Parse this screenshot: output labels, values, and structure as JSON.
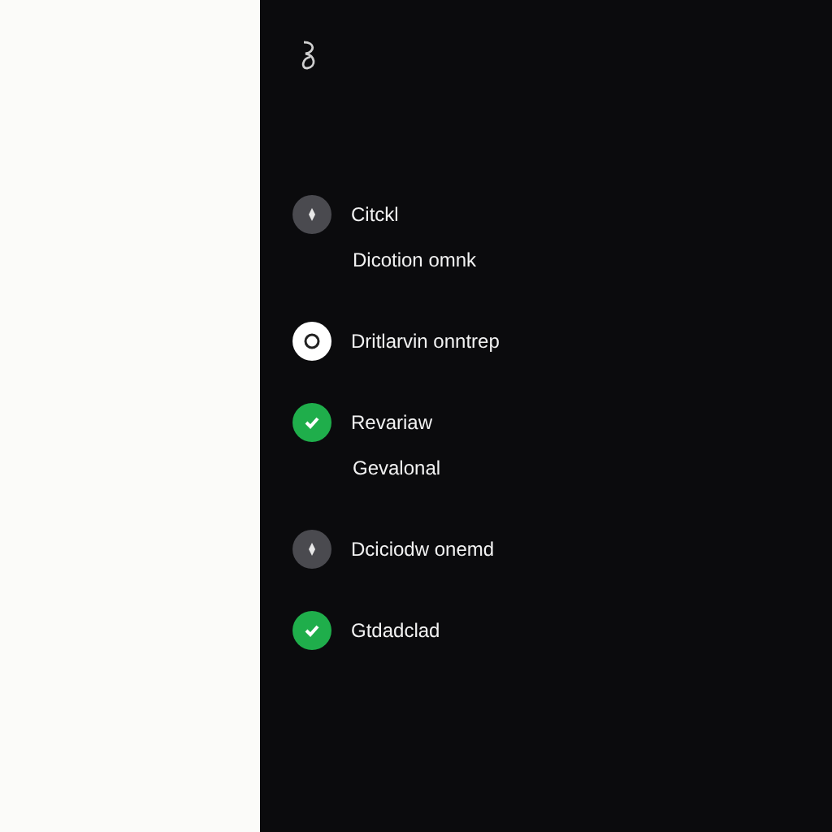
{
  "timeline": [
    {
      "kind": "step",
      "completed": false,
      "selected": false,
      "label": "Citckl"
    },
    {
      "kind": "note",
      "label": "Dicotion omnk"
    },
    {
      "kind": "step",
      "completed": false,
      "selected": true,
      "label": "Dritlarvin onntrep"
    },
    {
      "kind": "step",
      "completed": true,
      "selected": false,
      "label": "Revariaw"
    },
    {
      "kind": "note",
      "label": "Gevalonal"
    },
    {
      "kind": "step",
      "completed": false,
      "selected": false,
      "label": "Dciciodw onemd"
    },
    {
      "kind": "step",
      "completed": true,
      "selected": false,
      "label": "Gtdadclad"
    }
  ]
}
